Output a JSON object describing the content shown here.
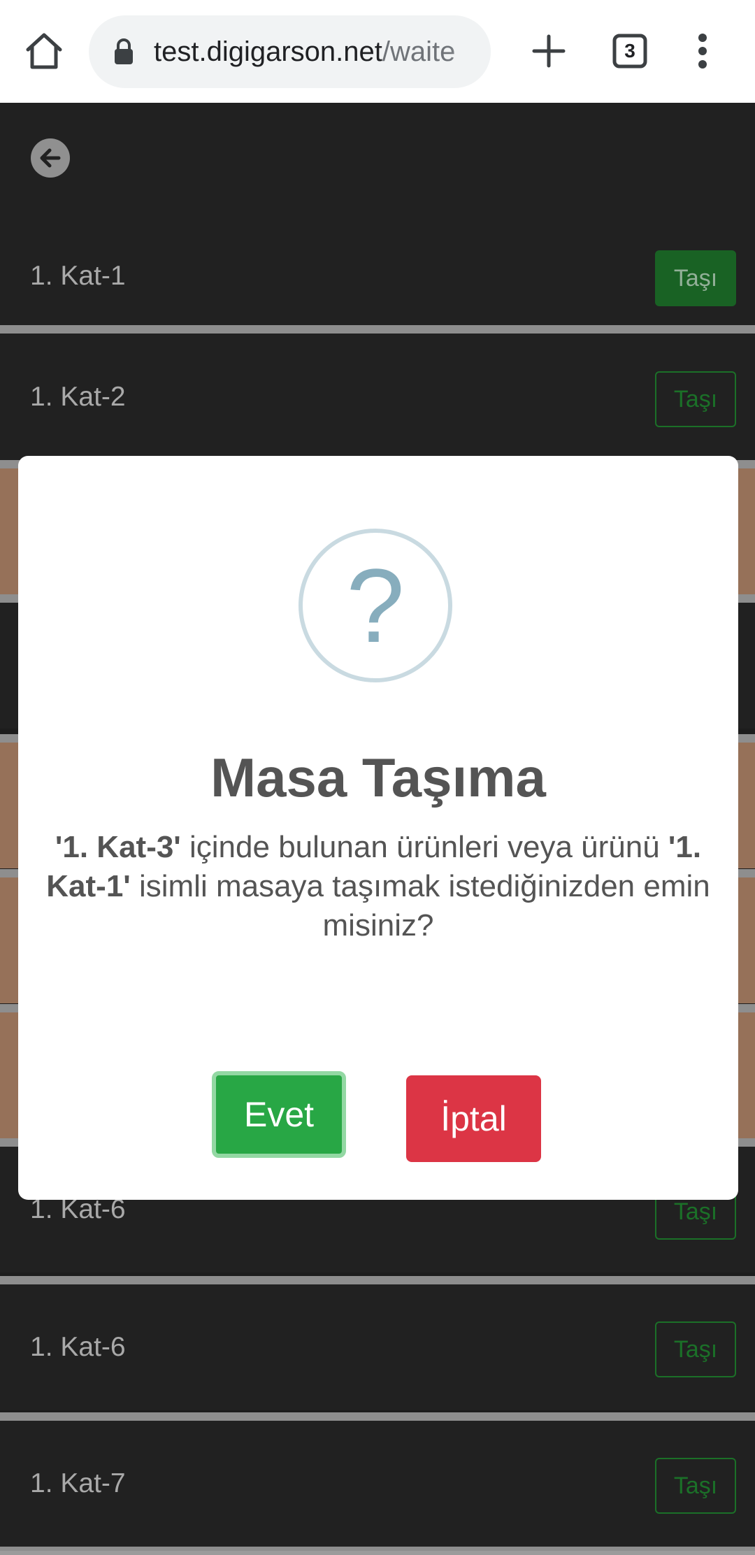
{
  "browser": {
    "url_main": "test.digigarson.net",
    "url_path": "/waite",
    "tab_count": "3",
    "icons": [
      "home-icon",
      "lock-icon",
      "plus-icon",
      "tabs-icon",
      "more-vert-icon"
    ]
  },
  "header": {
    "back_icon": "arrow-left-icon"
  },
  "tables": [
    {
      "label": "1. Kat-1",
      "button": "Taşı"
    },
    {
      "label": "1. Kat-2",
      "button": "Taşı"
    },
    {
      "label": "1. Kat-6",
      "button": "Taşı"
    },
    {
      "label": "1. Kat-6",
      "button": "Taşı"
    },
    {
      "label": "1. Kat-7",
      "button": "Taşı"
    }
  ],
  "dialog": {
    "icon": "question-mark",
    "icon_glyph": "?",
    "title": "Masa Taşıma",
    "source_table": "'1. Kat-3'",
    "text_1": " içinde bulunan ürünleri veya ürünü ",
    "target_table": "'1. Kat-1'",
    "text_2": " isimli masaya taşımak istediğinizden emin misiniz?",
    "confirm_label": "Evet",
    "cancel_label": "İptal"
  },
  "colors": {
    "confirm": "#28a745",
    "cancel": "#dc3545",
    "move_button": "#1e7a2c",
    "row_highlight": "#a37b61"
  }
}
